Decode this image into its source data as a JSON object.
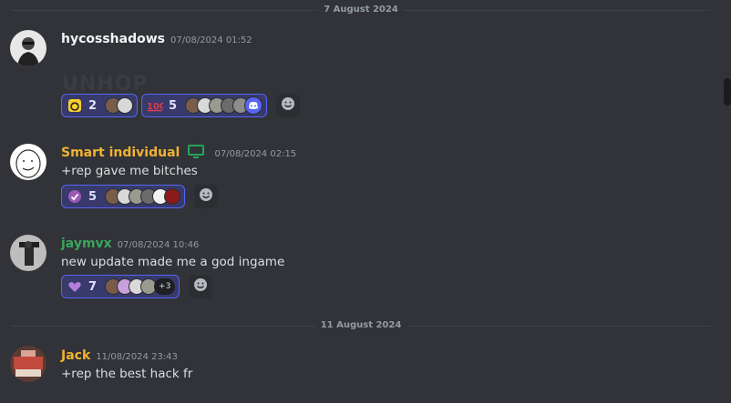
{
  "dividers": [
    "7 August 2024",
    "11 August 2024"
  ],
  "messages": [
    {
      "author": "hycosshadows",
      "author_color": "#f2f3f5",
      "timestamp": "07/08/2024 01:52",
      "content": "",
      "image_text": "UNHOP",
      "reactions": [
        {
          "emoji": "yellow-face-emoji",
          "count": "2"
        },
        {
          "emoji": "hundred-emoji",
          "count": "5"
        }
      ]
    },
    {
      "author": "Smart individual",
      "author_color": "#f0b232",
      "badge": "monitor-icon",
      "timestamp": "07/08/2024 02:15",
      "content": "+rep gave me bitches",
      "reactions": [
        {
          "emoji": "purple-check-emoji",
          "count": "5"
        }
      ]
    },
    {
      "author": "jaymvx",
      "author_color": "#3ba55d",
      "timestamp": "07/08/2024 10:46",
      "content": "new update made me a god ingame",
      "reactions": [
        {
          "emoji": "purple-heart-emoji",
          "count": "7",
          "more": "+3"
        }
      ]
    },
    {
      "author": "Jack",
      "author_color": "#f0b232",
      "timestamp": "11/08/2024 23:43",
      "content": "+rep the best hack fr",
      "reactions": []
    }
  ],
  "colors": {
    "background": "#313338",
    "accent": "#5865f2"
  }
}
